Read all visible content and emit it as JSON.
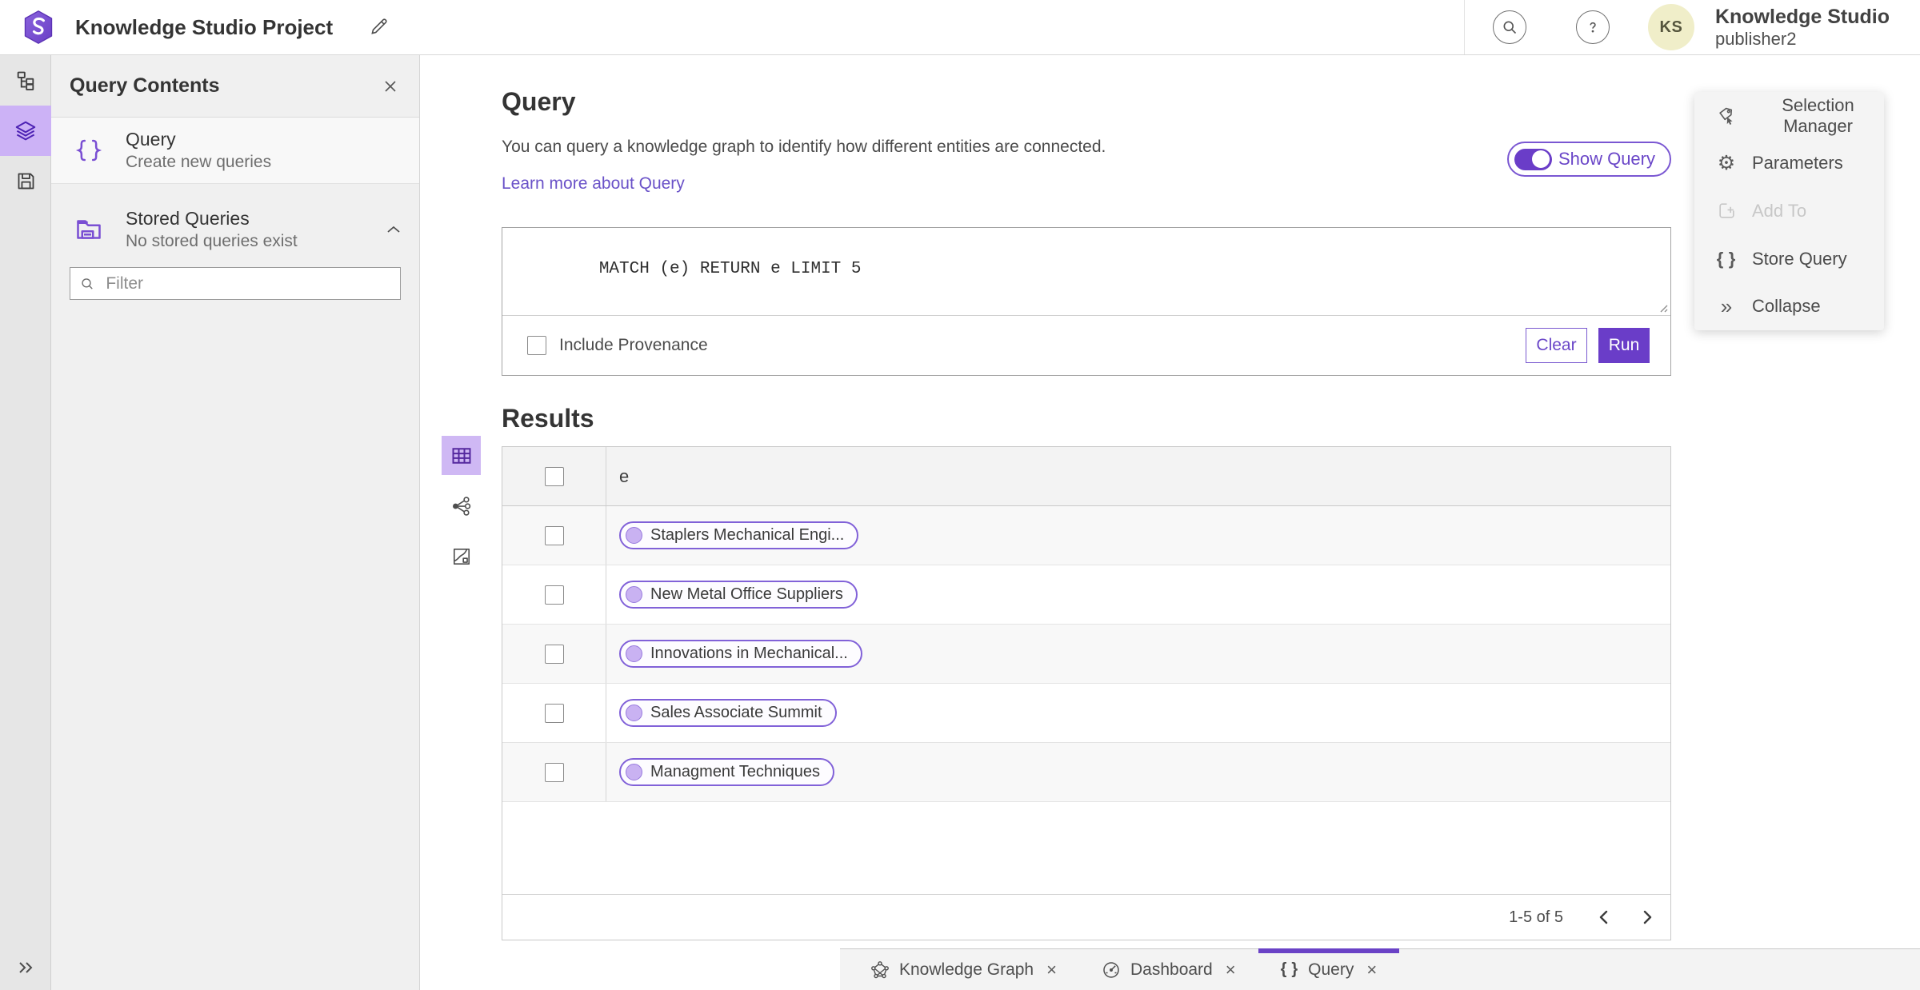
{
  "topbar": {
    "title": "Knowledge Studio Project",
    "app_name": "Knowledge Studio",
    "username": "publisher2",
    "avatar_initials": "KS"
  },
  "contents_panel": {
    "title": "Query Contents",
    "items": [
      {
        "title": "Query",
        "subtitle": "Create new queries"
      },
      {
        "title": "Stored Queries",
        "subtitle": "No stored queries exist"
      }
    ],
    "filter_placeholder": "Filter"
  },
  "query_section": {
    "heading": "Query",
    "description": "You can query a knowledge graph to identify how different entities are connected.",
    "link": "Learn more about Query",
    "show_query_label": "Show Query",
    "query_text": "MATCH (e) RETURN e LIMIT 5",
    "include_provenance_label": "Include Provenance",
    "clear_label": "Clear",
    "run_label": "Run"
  },
  "results": {
    "heading": "Results",
    "column_header": "e",
    "rows": [
      "Staplers Mechanical Engi...",
      "New Metal Office Suppliers",
      "Innovations in Mechanical...",
      "Sales Associate Summit",
      "Managment Techniques"
    ],
    "pagination": "1-5 of 5"
  },
  "action_panel": {
    "items": [
      {
        "label": "Selection Manager"
      },
      {
        "label": "Parameters"
      },
      {
        "label": "Add To"
      },
      {
        "label": "Store Query"
      },
      {
        "label": "Collapse"
      }
    ]
  },
  "bottom_tabs": [
    {
      "label": "Knowledge Graph"
    },
    {
      "label": "Dashboard"
    },
    {
      "label": "Query"
    }
  ],
  "colors": {
    "accent": "#6a3dc8",
    "accent_light": "#ccb2f6",
    "avatar_bg": "#f0eec9"
  }
}
